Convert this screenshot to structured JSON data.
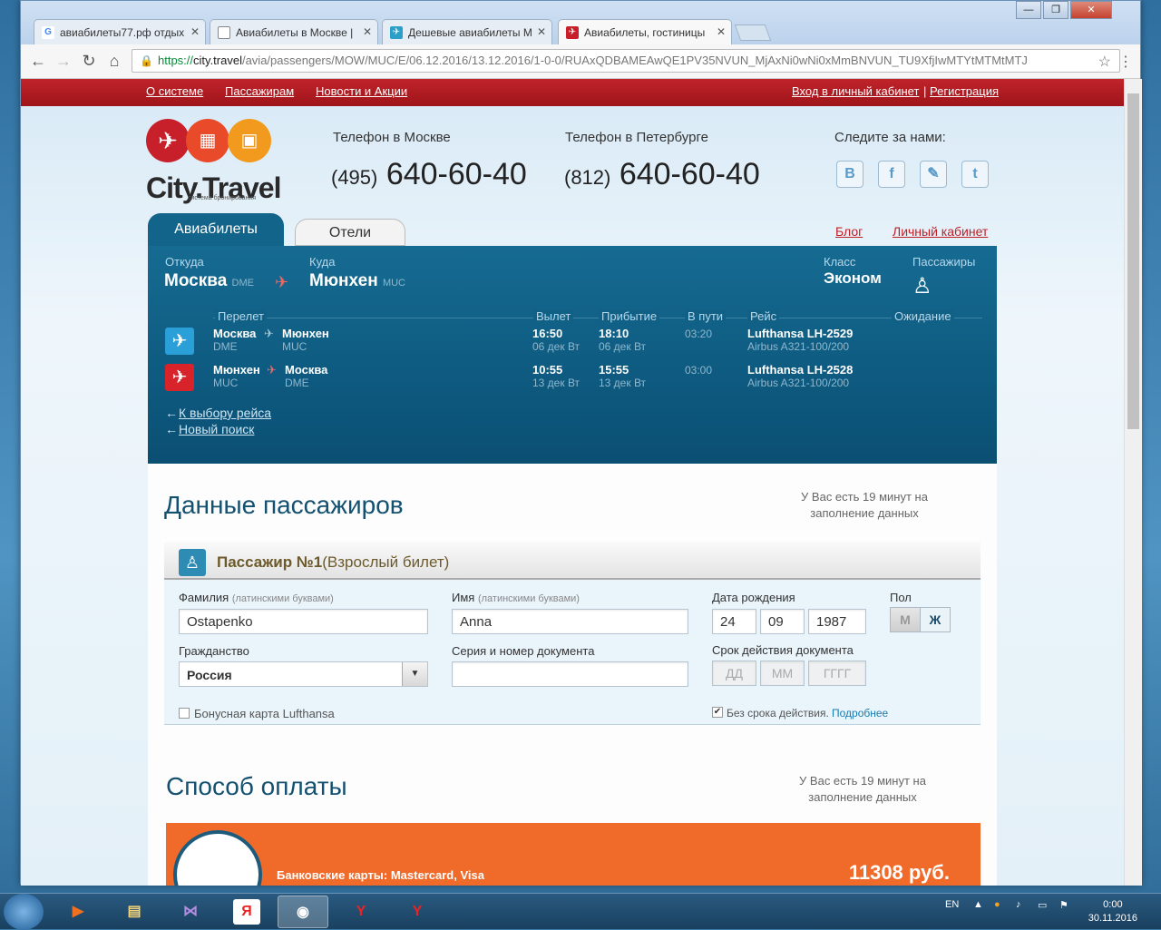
{
  "browser": {
    "tabs": [
      {
        "label": "авиабилеты77.рф отдых",
        "icon": "google-icon",
        "color": "#4285f4"
      },
      {
        "label": "Авиабилеты в Москве |",
        "icon": "page-icon",
        "color": "#888888"
      },
      {
        "label": "Дешевые авиабилеты М",
        "icon": "plane-icon",
        "color": "#2aa0c8"
      },
      {
        "label": "Авиабилеты, гостиницы",
        "icon": "citytravel-icon",
        "color": "#c8202a"
      }
    ],
    "url_scheme": "https://",
    "url_domain": "city.travel",
    "url_path": "/avia/passengers/MOW/MUC/E/06.12.2016/13.12.2016/1-0-0/RUAxQDBAMEAwQE1PV35NVUN_MjAxNi0wNi0xMmBNVUN_TU9XfjIwMTYtMTMtMTJ"
  },
  "topnav": {
    "left": [
      "О системе",
      "Пассажирам",
      "Новости и Акции"
    ],
    "login": "Вход в личный кабинет",
    "sep": "|",
    "register": "Регистрация"
  },
  "header": {
    "logo_text": "City.Travel",
    "logo_sub": "система бронирования",
    "phone_moscow_label": "Телефон в Москве",
    "phone_moscow_code": "(495)",
    "phone_moscow_num": "640-60-40",
    "phone_spb_label": "Телефон в Петербурге",
    "phone_spb_code": "(812)",
    "phone_spb_num": "640-60-40",
    "follow_label": "Следите за нами:",
    "social": [
      "В",
      "f",
      "✎",
      "t"
    ]
  },
  "tabs": {
    "avia": "Авиабилеты",
    "hotels": "Отели",
    "blog": "Блог",
    "cabinet": "Личный кабинет"
  },
  "search": {
    "from_label": "Откуда",
    "from_city": "Москва",
    "from_code": "DME",
    "to_label": "Куда",
    "to_city": "Мюнхен",
    "to_code": "MUC",
    "class_label": "Класс",
    "class_value": "Эконом",
    "pax_label": "Пассажиры"
  },
  "flights": {
    "headers": {
      "route": "Перелет",
      "dep": "Вылет",
      "arr": "Прибытие",
      "dur": "В пути",
      "flight": "Рейс",
      "wait": "Ожидание"
    },
    "rows": [
      {
        "from": "Москва",
        "from_code": "DME",
        "to": "Мюнхен",
        "to_code": "MUC",
        "dep": "16:50",
        "dep_date": "06 дек Вт",
        "arr": "18:10",
        "arr_date": "06 дек Вт",
        "dur": "03:20",
        "flight": "Lufthansa LH-2529",
        "aircraft": "Airbus A321-100/200"
      },
      {
        "from": "Мюнхен",
        "from_code": "MUC",
        "to": "Москва",
        "to_code": "DME",
        "dep": "10:55",
        "dep_date": "13 дек Вт",
        "arr": "15:55",
        "arr_date": "13 дек Вт",
        "dur": "03:00",
        "flight": "Lufthansa LH-2528",
        "aircraft": "Airbus A321-100/200"
      }
    ],
    "back_link": "К выбору рейса",
    "new_search": "Новый поиск"
  },
  "passengers": {
    "title": "Данные пассажиров",
    "timer": "У Вас есть 19 минут на заполнение данных",
    "pax_title": "Пассажир №1",
    "pax_type": "(Взрослый билет)",
    "surname_label": "Фамилия",
    "latin_hint": "(латинскими буквами)",
    "surname": "Ostapenko",
    "name_label": "Имя",
    "name": "Anna",
    "dob_label": "Дата рождения",
    "dob_day": "24",
    "dob_month": "09",
    "dob_year": "1987",
    "gender_label": "Пол",
    "gender_m": "М",
    "gender_f": "Ж",
    "citizenship_label": "Гражданство",
    "citizenship": "Россия",
    "doc_label": "Серия и номер документа",
    "doc_value": "",
    "expiry_label": "Срок действия документа",
    "exp_day_ph": "ДД",
    "exp_month_ph": "ММ",
    "exp_year_ph": "ГГГГ",
    "bonus_label": "Бонусная карта Lufthansa",
    "no_expiry_label": "Без срока действия.",
    "more_link": "Подробнее"
  },
  "payment": {
    "title": "Способ оплаты",
    "timer": "У Вас есть 19 минут на заполнение данных",
    "method": "Банковские карты: Mastercard, Visa",
    "amount": "11308 руб."
  },
  "taskbar": {
    "lang": "EN",
    "time": "0:00",
    "date": "30.11.2016"
  }
}
